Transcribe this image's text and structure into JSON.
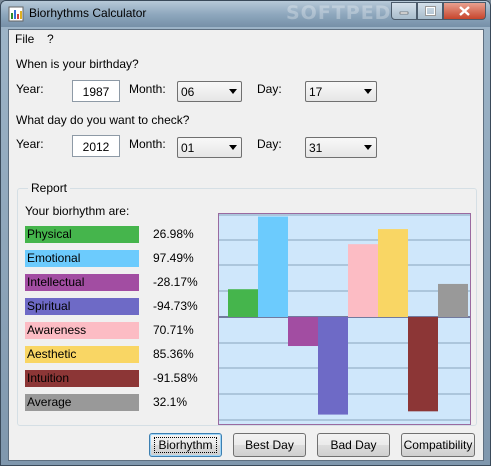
{
  "window": {
    "title": "Biorhythms Calculator",
    "watermark": "SOFTPEDIA"
  },
  "menu": [
    "File",
    "?"
  ],
  "birthday": {
    "prompt": "When is your birthday?",
    "year_label": "Year:",
    "year": "1987",
    "month_label": "Month:",
    "month": "06",
    "day_label": "Day:",
    "day": "17"
  },
  "check": {
    "prompt": "What day do you want to check?",
    "year_label": "Year:",
    "year": "2012",
    "month_label": "Month:",
    "month": "01",
    "day_label": "Day:",
    "day": "31"
  },
  "report": {
    "legend": "Report",
    "heading": "Your biorhythm are:",
    "items": [
      {
        "label": "Physical",
        "value": "26.98%",
        "color": "#45b54c"
      },
      {
        "label": "Emotional",
        "value": "97.49%",
        "color": "#6ccbfd"
      },
      {
        "label": "Intellectual",
        "value": "-28.17%",
        "color": "#a24da2"
      },
      {
        "label": "Spiritual",
        "value": "-94.73%",
        "color": "#6e6ac6"
      },
      {
        "label": "Awareness",
        "value": "70.71%",
        "color": "#fcbcc4"
      },
      {
        "label": "Aesthetic",
        "value": "85.36%",
        "color": "#f9d664"
      },
      {
        "label": "Intuition",
        "value": "-91.58%",
        "color": "#8c3636"
      },
      {
        "label": "Average",
        "value": "32.1%",
        "color": "#999999"
      }
    ]
  },
  "chart_data": {
    "type": "bar",
    "categories": [
      "Physical",
      "Emotional",
      "Intellectual",
      "Spiritual",
      "Awareness",
      "Aesthetic",
      "Intuition",
      "Average"
    ],
    "values": [
      26.98,
      97.49,
      -28.17,
      -94.73,
      70.71,
      85.36,
      -91.58,
      32.1
    ],
    "colors": [
      "#45b54c",
      "#6ccbfd",
      "#a24da2",
      "#6e6ac6",
      "#fcbcc4",
      "#f9d664",
      "#8c3636",
      "#999999"
    ],
    "ylim": [
      -100,
      100
    ],
    "grid": true
  },
  "buttons": [
    "Biorhythm",
    "Best Day",
    "Bad Day",
    "Compatibility"
  ]
}
